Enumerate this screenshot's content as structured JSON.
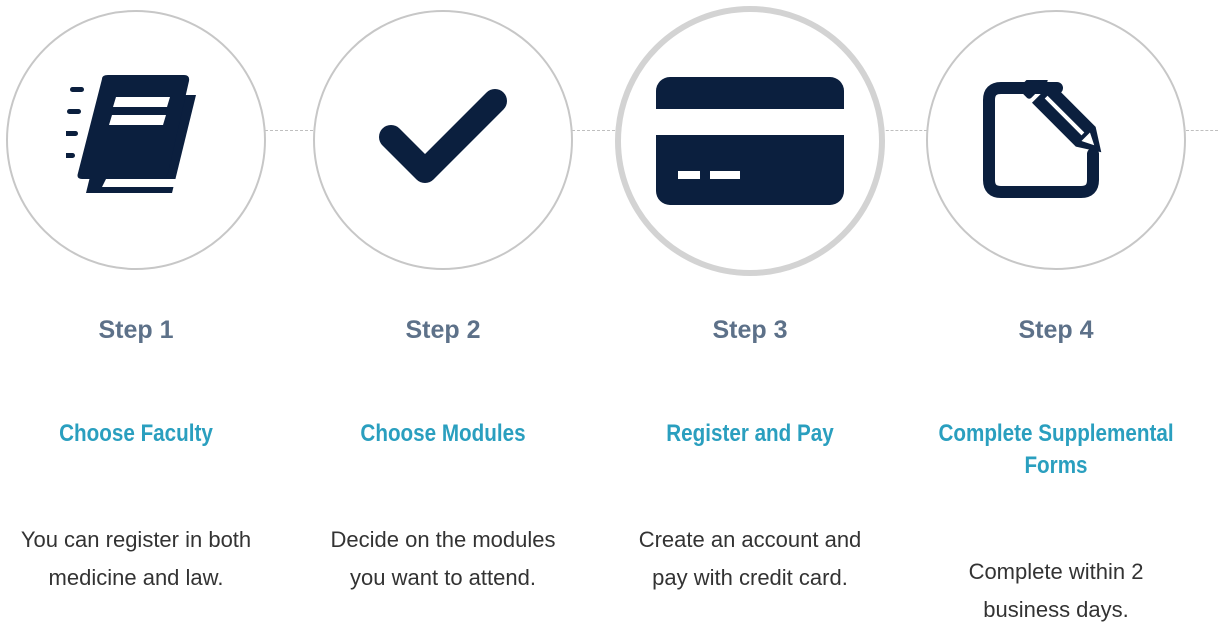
{
  "colors": {
    "icon": "#0b1f3e",
    "step_label": "#5d7189",
    "title": "#2a9fbf",
    "description": "#333333",
    "circle_border": "#c7c7c7",
    "connector": "#bfbfbf"
  },
  "steps": [
    {
      "label": "Step 1",
      "title": "Choose Faculty",
      "description": "You can register in both medicine and law.",
      "icon": "book-icon",
      "active": false
    },
    {
      "label": "Step 2",
      "title": "Choose Modules",
      "description": "Decide on the modules you want to attend.",
      "icon": "checkmark-icon",
      "active": false
    },
    {
      "label": "Step 3",
      "title": "Register and Pay",
      "description": "Create an account and pay with credit card.",
      "icon": "credit-card-icon",
      "active": true
    },
    {
      "label": "Step 4",
      "title": "Complete Supplemental Forms",
      "description": "Complete within 2 business days.",
      "icon": "edit-form-icon",
      "active": false
    }
  ]
}
